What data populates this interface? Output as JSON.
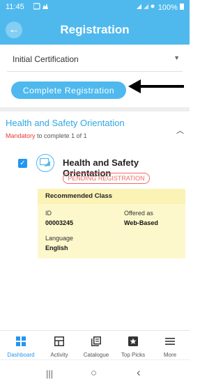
{
  "status_bar": {
    "time": "11:45",
    "battery": "100%"
  },
  "header": {
    "title": "Registration"
  },
  "certification_select": {
    "selected": "Initial Certification"
  },
  "complete_button": {
    "label": "Complete Registration"
  },
  "section": {
    "title": "Health and Safety Orientation",
    "mandatory": "Mandatory",
    "progress": "to complete 1 of 1"
  },
  "course": {
    "title": "Health and Safety Orientation",
    "status": "PENDING REGISTRATION",
    "checked": true,
    "recommended": {
      "heading": "Recommended Class",
      "id_label": "ID",
      "id_value": "00003245",
      "offered_label": "Offered as",
      "offered_value": "Web-Based",
      "language_label": "Language",
      "language_value": "English"
    }
  },
  "bottom_nav": {
    "items": [
      {
        "label": "Dashboard",
        "icon": "dashboard-icon",
        "active": true
      },
      {
        "label": "Activity",
        "icon": "activity-icon",
        "active": false
      },
      {
        "label": "Catalogue",
        "icon": "catalogue-icon",
        "active": false
      },
      {
        "label": "Top Picks",
        "icon": "top-picks-icon",
        "active": false
      },
      {
        "label": "More",
        "icon": "menu-icon",
        "active": false
      }
    ]
  },
  "system_nav": {
    "recent": "|||",
    "home": "○",
    "back": "‹"
  },
  "colors": {
    "primary": "#4fb9ee",
    "accent_blue": "#2196f3",
    "mandatory_red": "#e53935",
    "badge_red": "#f06a6a",
    "recommended_bg": "#fdf8cc"
  }
}
